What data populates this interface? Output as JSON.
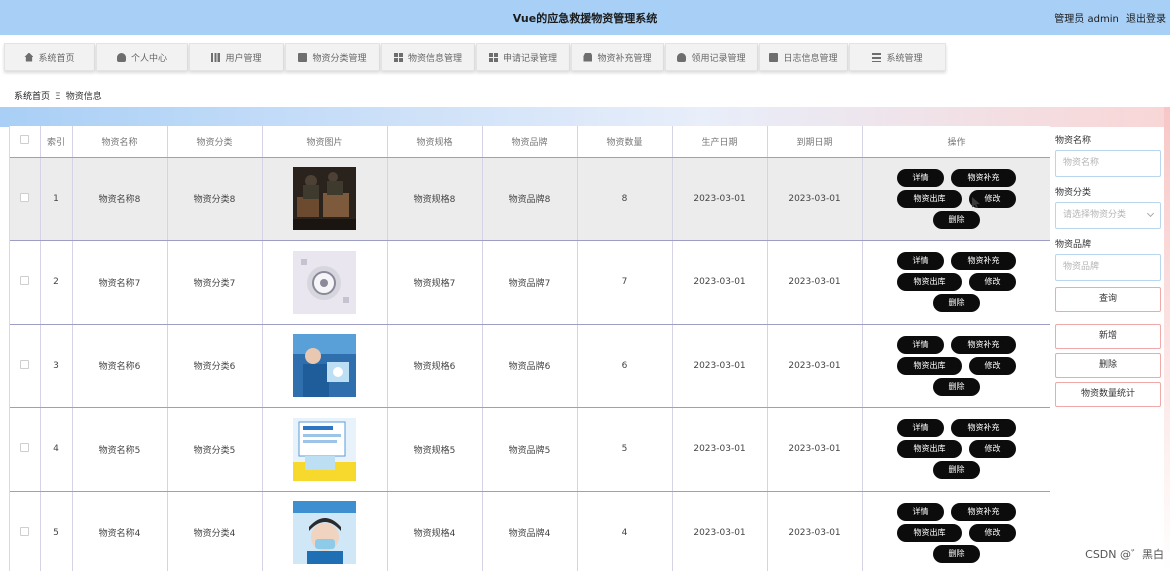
{
  "header": {
    "title": "Vue的应急救援物资管理系统",
    "user_label": "管理员 admin",
    "logout_label": "退出登录"
  },
  "nav": {
    "items": [
      {
        "label": "系统首页",
        "icon": "home-icon"
      },
      {
        "label": "个人中心",
        "icon": "person-icon"
      },
      {
        "label": "用户管理",
        "icon": "bar-chart-icon"
      },
      {
        "label": "物资分类管理",
        "icon": "clipboard-icon"
      },
      {
        "label": "物资信息管理",
        "icon": "grid-icon"
      },
      {
        "label": "申请记录管理",
        "icon": "grid-icon"
      },
      {
        "label": "物资补充管理",
        "icon": "box-icon"
      },
      {
        "label": "领用记录管理",
        "icon": "person-icon"
      },
      {
        "label": "日志信息管理",
        "icon": "printer-icon"
      },
      {
        "label": "系统管理",
        "icon": "list-icon"
      }
    ]
  },
  "breadcrumb": {
    "home": "系统首页",
    "separator": "Ξ",
    "current": "物资信息"
  },
  "table": {
    "headers": [
      "",
      "索引",
      "物资名称",
      "物资分类",
      "物资图片",
      "物资规格",
      "物资品牌",
      "物资数量",
      "生产日期",
      "到期日期",
      "操作"
    ],
    "rows": [
      {
        "index": "1",
        "name": "物资名称8",
        "category": "物资分类8",
        "spec": "物资规格8",
        "brand": "物资品牌8",
        "qty": "8",
        "prod_date": "2023-03-01",
        "exp_date": "2023-03-01"
      },
      {
        "index": "2",
        "name": "物资名称7",
        "category": "物资分类7",
        "spec": "物资规格7",
        "brand": "物资品牌7",
        "qty": "7",
        "prod_date": "2023-03-01",
        "exp_date": "2023-03-01"
      },
      {
        "index": "3",
        "name": "物资名称6",
        "category": "物资分类6",
        "spec": "物资规格6",
        "brand": "物资品牌6",
        "qty": "6",
        "prod_date": "2023-03-01",
        "exp_date": "2023-03-01"
      },
      {
        "index": "4",
        "name": "物资名称5",
        "category": "物资分类5",
        "spec": "物资规格5",
        "brand": "物资品牌5",
        "qty": "5",
        "prod_date": "2023-03-01",
        "exp_date": "2023-03-01"
      },
      {
        "index": "5",
        "name": "物资名称4",
        "category": "物资分类4",
        "spec": "物资规格4",
        "brand": "物资品牌4",
        "qty": "4",
        "prod_date": "2023-03-01",
        "exp_date": "2023-03-01"
      }
    ],
    "actions": {
      "detail": "详情",
      "replenish": "物资补充",
      "outbound": "物资出库",
      "edit": "修改",
      "delete": "删除"
    }
  },
  "search": {
    "name_label": "物资名称",
    "name_placeholder": "物资名称",
    "category_label": "物资分类",
    "category_placeholder": "请选择物资分类",
    "brand_label": "物资品牌",
    "brand_placeholder": "物资品牌",
    "query_label": "查询",
    "add_label": "新增",
    "delete_label": "删除",
    "stats_label": "物资数量统计"
  },
  "watermark": "CSDN @゛黑白"
}
